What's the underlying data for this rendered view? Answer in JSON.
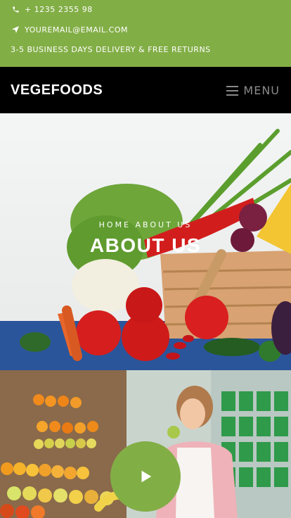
{
  "topbar": {
    "phone": "+ 1235 2355 98",
    "email": "YOUREMAIL@EMAIL.COM",
    "shipping": "3-5 BUSINESS DAYS DELIVERY & FREE RETURNS",
    "background": "#82ae46"
  },
  "navbar": {
    "brand": "VEGEFOODS",
    "menu_label": "MENU",
    "background": "#000000"
  },
  "hero": {
    "breadcrumb": "HOME  ABOUT US",
    "title": "ABOUT US"
  },
  "video": {
    "play_icon": "play-icon",
    "accent": "#82ae46"
  }
}
